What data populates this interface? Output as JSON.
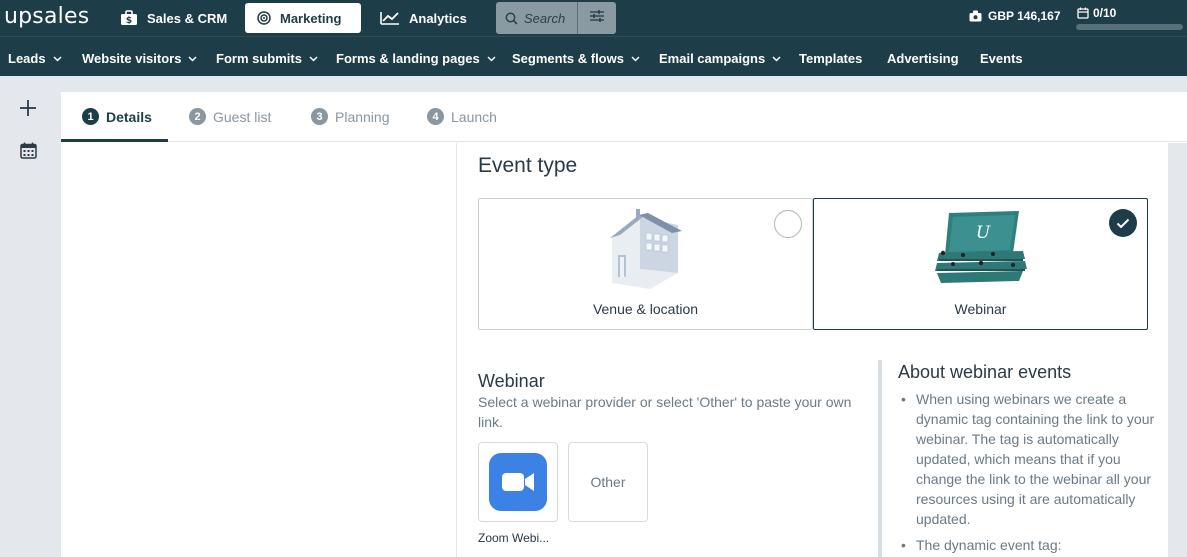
{
  "app": {
    "logo": "upsales"
  },
  "topnav": {
    "items": [
      {
        "label": "Sales & CRM",
        "icon": "briefcase-dollar-icon",
        "active": false
      },
      {
        "label": "Marketing",
        "icon": "target-icon",
        "active": true
      },
      {
        "label": "Analytics",
        "icon": "line-chart-icon",
        "active": false
      }
    ],
    "search_placeholder": "Search",
    "currency": "GBP 146,167",
    "quota": "0/10",
    "quota_progress": 0
  },
  "subnav": {
    "items": [
      {
        "label": "Leads",
        "dropdown": true
      },
      {
        "label": "Website visitors",
        "dropdown": true
      },
      {
        "label": "Form submits",
        "dropdown": true
      },
      {
        "label": "Forms & landing pages",
        "dropdown": true
      },
      {
        "label": "Segments & flows",
        "dropdown": true
      },
      {
        "label": "Email campaigns",
        "dropdown": true
      },
      {
        "label": "Templates",
        "dropdown": false
      },
      {
        "label": "Advertising",
        "dropdown": false
      },
      {
        "label": "Events",
        "dropdown": false
      }
    ]
  },
  "wizard": {
    "steps": [
      {
        "num": "1",
        "label": "Details",
        "active": true
      },
      {
        "num": "2",
        "label": "Guest list",
        "active": false
      },
      {
        "num": "3",
        "label": "Planning",
        "active": false
      },
      {
        "num": "4",
        "label": "Launch",
        "active": false
      }
    ]
  },
  "event_type": {
    "heading": "Event type",
    "options": [
      {
        "label": "Venue & location",
        "icon": "house-icon",
        "selected": false
      },
      {
        "label": "Webinar",
        "icon": "lecture-hall-icon",
        "selected": true,
        "logo_letter": "U"
      }
    ]
  },
  "webinar": {
    "heading": "Webinar",
    "description": "Select a webinar provider or select 'Other' to paste your own link.",
    "providers": [
      {
        "label": "Zoom Webi...",
        "icon": "zoom-camera-icon"
      },
      {
        "label": "Other"
      }
    ]
  },
  "about": {
    "heading": "About webinar events",
    "bullets": [
      "When using webinars we create a dynamic tag containing the link to your webinar. The tag is automatically updated, which means that if you change the link to the webinar all your resources using it are automatically updated.",
      "The dynamic event tag:"
    ]
  },
  "colors": {
    "brand_dark": "#1d3d48",
    "zoom_blue": "#3b82e4",
    "background": "#e4e8ec"
  }
}
